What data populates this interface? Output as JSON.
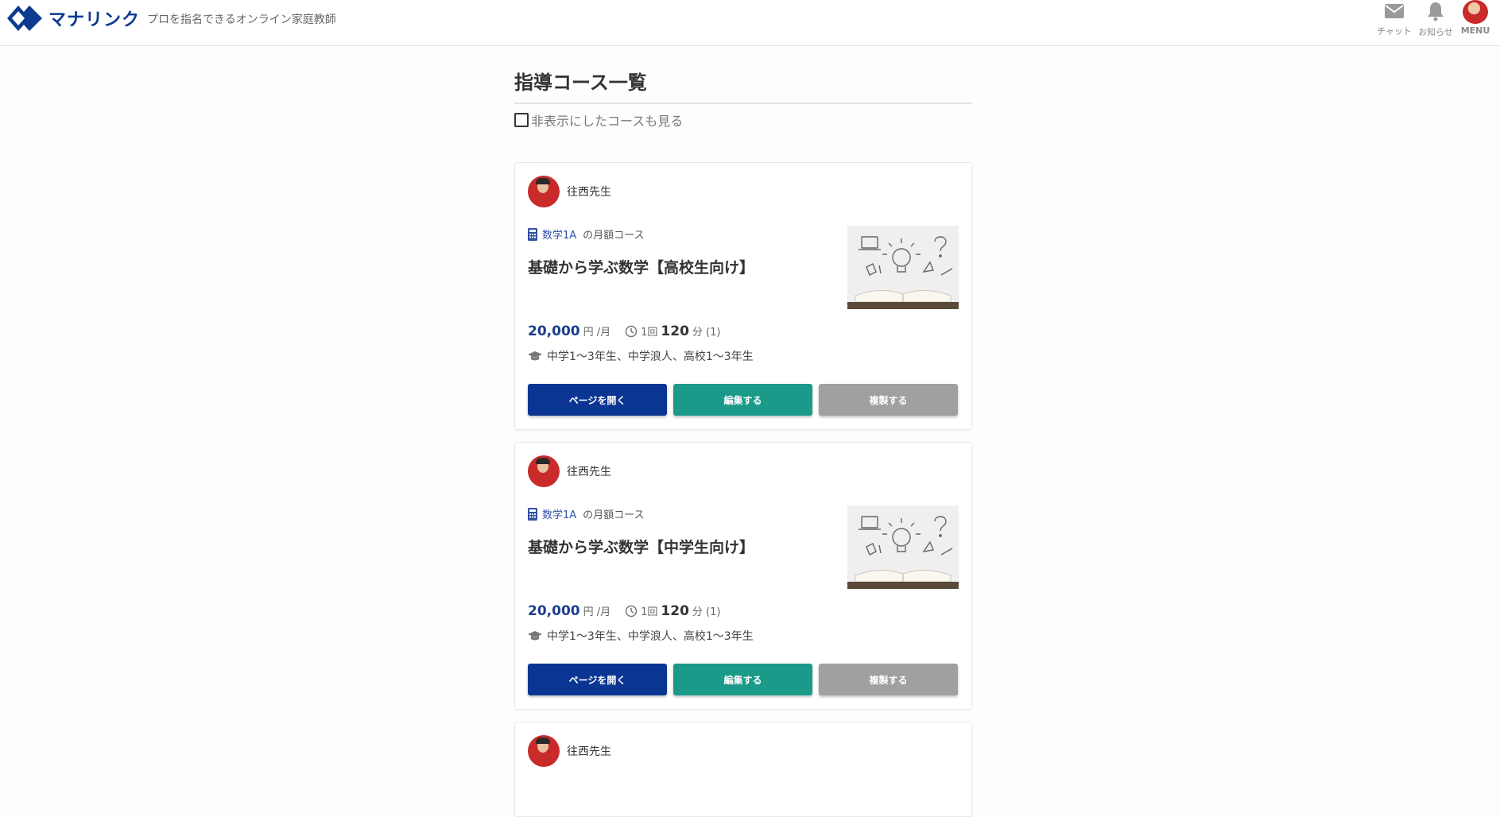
{
  "header": {
    "logo_text": "マナリンク",
    "tagline": "プロを指名できるオンライン家庭教師",
    "chat_label": "チャット",
    "notice_label": "お知らせ",
    "menu_label": "MENU"
  },
  "main": {
    "title": "指導コース一覧",
    "show_hidden_label": "非表示にしたコースも見る"
  },
  "courses": [
    {
      "teacher": "往西先生",
      "subject": "数学1A",
      "course_type": "の月額コース",
      "title": "基礎から学ぶ数学【高校生向け】",
      "price": "20,000",
      "price_unit": "円 /月",
      "per_session": "1回",
      "minutes": "120",
      "minutes_unit": "分 (1)",
      "grades": "中学1～3年生、中学浪人、高校1～3年生",
      "btn_open": "ページを開く",
      "btn_edit": "編集する",
      "btn_copy": "複製する"
    },
    {
      "teacher": "往西先生",
      "subject": "数学1A",
      "course_type": "の月額コース",
      "title": "基礎から学ぶ数学【中学生向け】",
      "price": "20,000",
      "price_unit": "円 /月",
      "per_session": "1回",
      "minutes": "120",
      "minutes_unit": "分 (1)",
      "grades": "中学1～3年生、中学浪人、高校1～3年生",
      "btn_open": "ページを開く",
      "btn_edit": "編集する",
      "btn_copy": "複製する"
    },
    {
      "teacher": "往西先生"
    }
  ],
  "colors": {
    "brand": "#0b3a8f",
    "open_button": "#0a3593",
    "edit_button": "#1b9a8a",
    "copy_button": "#a0a0a0",
    "price": "#1c3d8f"
  }
}
